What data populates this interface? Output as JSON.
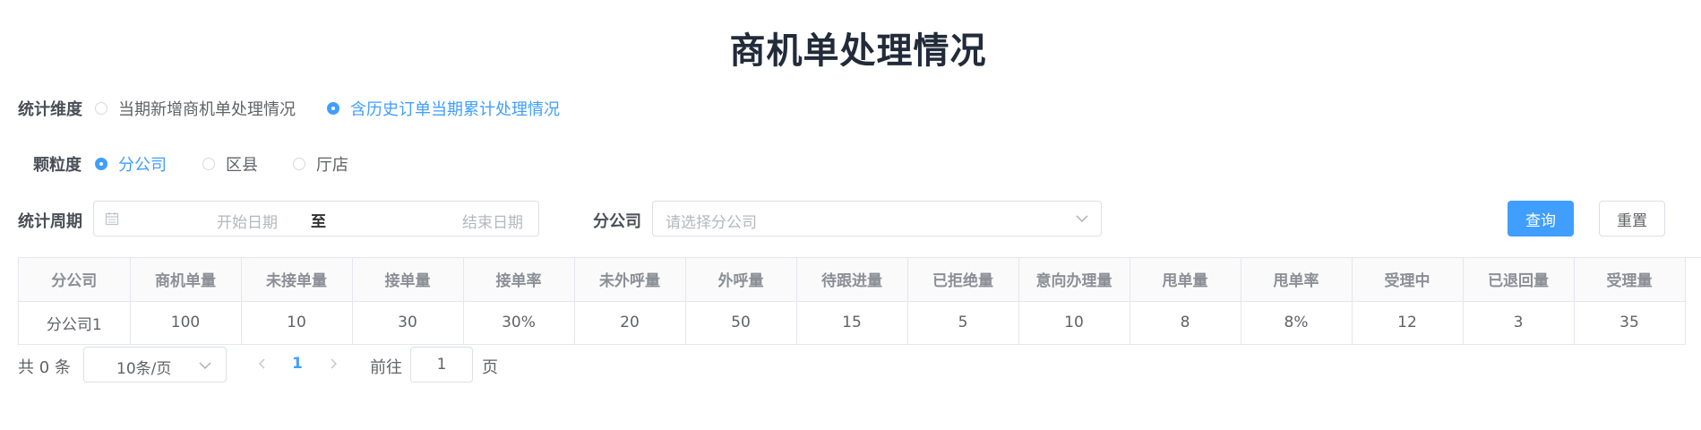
{
  "title": "商机单处理情况",
  "dimension": {
    "label": "统计维度",
    "options": [
      {
        "label": "当期新增商机单处理情况",
        "checked": false
      },
      {
        "label": "含历史订单当期累计处理情况",
        "checked": true
      }
    ]
  },
  "granularity": {
    "label": "颗粒度",
    "options": [
      {
        "label": "分公司",
        "checked": true
      },
      {
        "label": "区县",
        "checked": false
      },
      {
        "label": "厅店",
        "checked": false
      }
    ]
  },
  "period": {
    "label": "统计周期",
    "start_placeholder": "开始日期",
    "separator": "至",
    "end_placeholder": "结束日期"
  },
  "branch": {
    "label": "分公司",
    "placeholder": "请选择分公司"
  },
  "buttons": {
    "query": "查询",
    "reset": "重置"
  },
  "table": {
    "columns": [
      "分公司",
      "商机单量",
      "未接单量",
      "接单量",
      "接单率",
      "未外呼量",
      "外呼量",
      "待跟进量",
      "已拒绝量",
      "意向办理量",
      "甩单量",
      "甩单率",
      "受理中",
      "已退回量",
      "受理量"
    ],
    "rows": [
      [
        "分公司1",
        "100",
        "10",
        "30",
        "30%",
        "20",
        "50",
        "15",
        "5",
        "10",
        "8",
        "8%",
        "12",
        "3",
        "35"
      ]
    ]
  },
  "pagination": {
    "total_text": "共 0 条",
    "page_size": "10条/页",
    "current_page": "1",
    "goto_label": "前往",
    "goto_value": "1",
    "goto_suffix": "页"
  },
  "colors": {
    "accent": "#409eff",
    "title": "#222b3a",
    "border": "#dcdfe6"
  }
}
